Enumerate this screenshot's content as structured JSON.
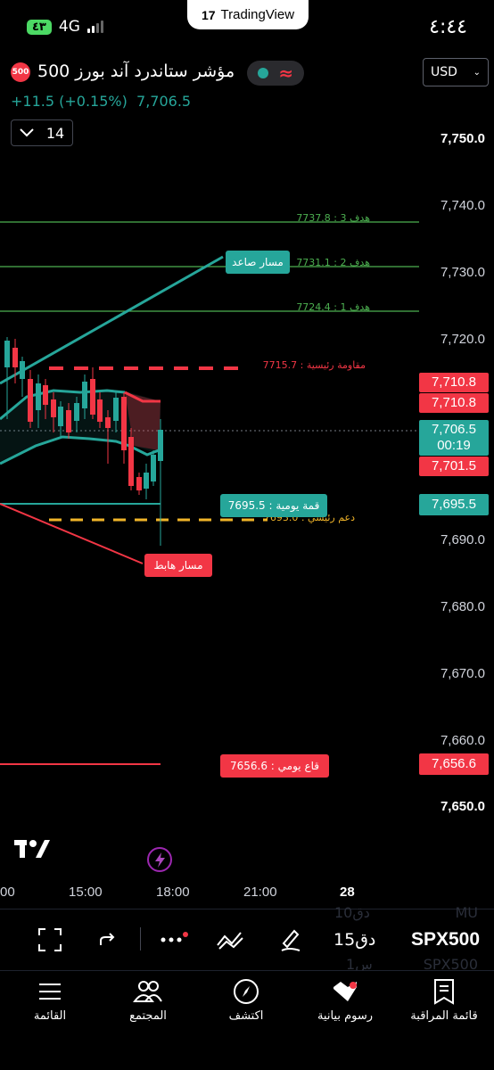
{
  "status_bar": {
    "time": "٤:٤٤",
    "battery": "٤٣",
    "network": "4G"
  },
  "app_badge": "TradingView",
  "header": {
    "symbol_badge": "500",
    "symbol_name": "مؤشر ستاندرد آند بورز 500",
    "change": "+11.5 (+0.15%)",
    "last_price": "7,706.5",
    "interval_value": "14",
    "currency": "USD"
  },
  "price_axis": [
    "7,750.0",
    "7,740.0",
    "7,730.0",
    "7,720.0",
    "7,690.0",
    "7,680.0",
    "7,670.0",
    "7,660.0",
    "7,650.0"
  ],
  "price_labels": {
    "resistance_1": "7,710.8",
    "resistance_2": "7,710.8",
    "current": "7,706.5",
    "countdown": "00:19",
    "low_mark": "7,701.5",
    "daily_high": "7,695.5",
    "daily_low": "7,656.6"
  },
  "annotations": {
    "target3": "هدف 3 : 7737.8",
    "target2": "هدف 2 : 7731.1",
    "target1": "هدف 1 : 7724.4",
    "major_resistance": "مقاومة رئيسية : 7715.7",
    "major_support": "دعم رئيسي : 7693.0",
    "uptrend": "مسار صاعد",
    "downtrend": "مسار هابط",
    "daily_high_tag": "قمة يومية : 7695.5",
    "daily_low_tag": "قاع يومي : 7656.6"
  },
  "time_axis": [
    "00",
    "15:00",
    "18:00",
    "21:00",
    "28"
  ],
  "toolbar": {
    "symbol": "SPX500",
    "interval": "15دق",
    "ghost_top_symbol": "MU",
    "ghost_top_int": "10دق",
    "ghost_bottom_symbol": "SPX500",
    "ghost_bottom_int": "1س"
  },
  "nav": [
    "قائمة المراقبة",
    "رسوم بيانية",
    "اكتشف",
    "المجتمع",
    "القائمة"
  ],
  "colors": {
    "up": "#26a69a",
    "down": "#f23645",
    "target": "#4caf50",
    "support": "#f0b429"
  }
}
